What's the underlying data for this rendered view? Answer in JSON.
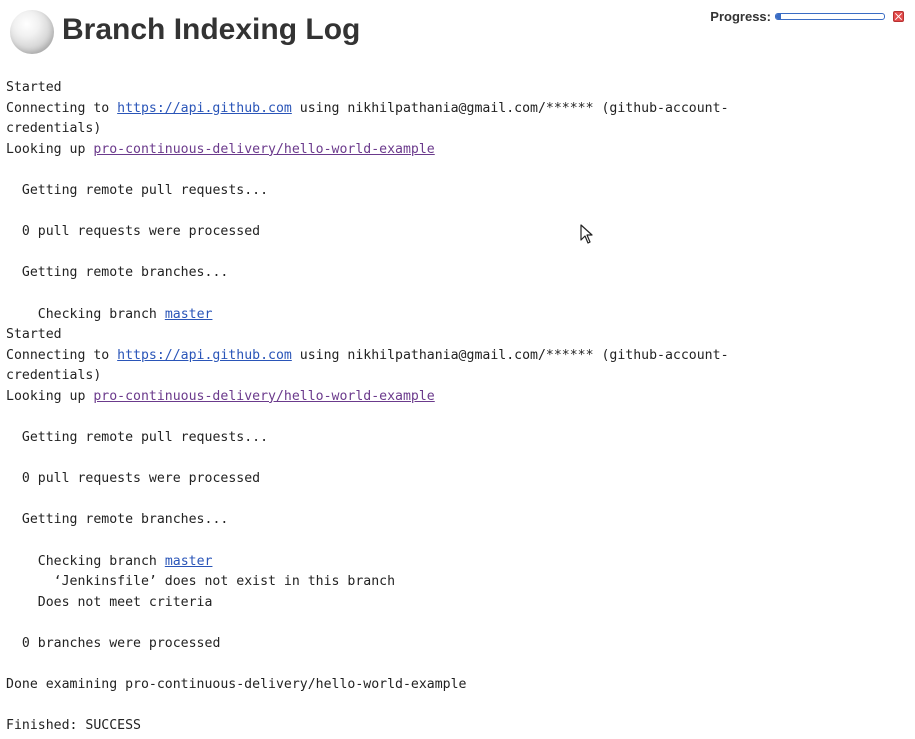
{
  "header": {
    "title": "Branch Indexing Log",
    "progress_label": "Progress:",
    "progress_value": 0.05,
    "status_icon": "grey-ball-icon",
    "stop_icon": "stop-icon"
  },
  "console": {
    "started_1": "Started",
    "connecting_1_prefix": "Connecting to ",
    "connecting_1_link": "https://api.github.com",
    "connecting_1_suffix": " using nikhilpathania@gmail.com/****** (github-account-",
    "connecting_1_cont": "credentials)",
    "lookup_1_prefix": "Looking up ",
    "lookup_1_link": "pro-continuous-delivery/hello-world-example",
    "pull_1": "  Getting remote pull requests...",
    "pull_processed_1": "  0 pull requests were processed",
    "branches_1": "  Getting remote branches...",
    "check_branch_1_prefix": "    Checking branch ",
    "check_branch_1_link": "master",
    "started_2": "Started",
    "connecting_2_prefix": "Connecting to ",
    "connecting_2_link": "https://api.github.com",
    "connecting_2_suffix": " using nikhilpathania@gmail.com/****** (github-account-",
    "connecting_2_cont": "credentials)",
    "lookup_2_prefix": "Looking up ",
    "lookup_2_link": "pro-continuous-delivery/hello-world-example",
    "pull_2": "  Getting remote pull requests...",
    "pull_processed_2": "  0 pull requests were processed",
    "branches_2": "  Getting remote branches...",
    "check_branch_2_prefix": "    Checking branch ",
    "check_branch_2_link": "master",
    "jenkinsfile_missing": "      ‘Jenkinsfile’ does not exist in this branch",
    "criteria": "    Does not meet criteria",
    "branches_processed": "  0 branches were processed",
    "done": "Done examining pro-continuous-delivery/hello-world-example",
    "finished": "Finished: SUCCESS"
  },
  "colors": {
    "link": "#2a55b8",
    "visited_link": "#6b3a8c",
    "progress": "#3a6cc4",
    "stop": "#e24b4b"
  }
}
